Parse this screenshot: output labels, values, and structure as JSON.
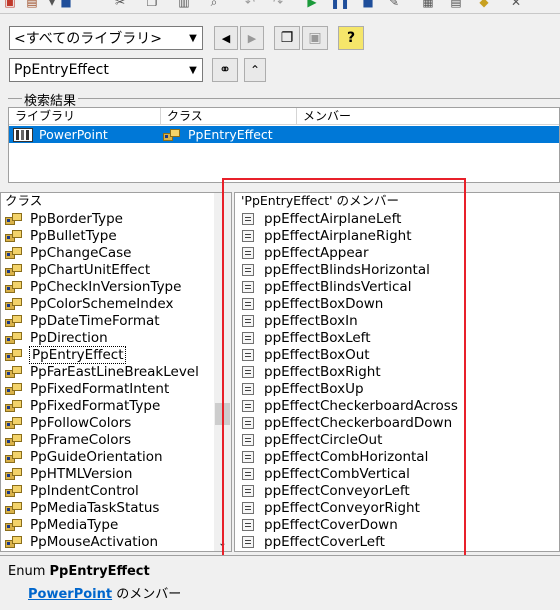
{
  "toolbar": {
    "icons": [
      "view-icon",
      "insert-icon",
      "save-icon",
      "cut-icon",
      "copy-icon",
      "paste-icon",
      "find-icon",
      "undo-icon",
      "redo-icon",
      "run-icon",
      "break-icon",
      "reset-icon",
      "design-icon",
      "project-icon",
      "properties-icon",
      "object-browser-icon",
      "toolbox-icon"
    ]
  },
  "library_combo": {
    "value": "<すべてのライブラリ>"
  },
  "search_combo": {
    "value": "PpEntryEffect"
  },
  "nav_buttons": {
    "back": "◀",
    "forward": "▶",
    "copy": "",
    "view_def": "",
    "help": "?"
  },
  "search_results": {
    "label": "検索結果",
    "columns": [
      "ライブラリ",
      "クラス",
      "メンバー"
    ],
    "row": {
      "library": "PowerPoint",
      "class": "PpEntryEffect",
      "member": ""
    }
  },
  "classes_pane": {
    "title": "クラス",
    "items": [
      "PpBorderType",
      "PpBulletType",
      "PpChangeCase",
      "PpChartUnitEffect",
      "PpCheckInVersionType",
      "PpColorSchemeIndex",
      "PpDateTimeFormat",
      "PpDirection",
      "PpEntryEffect",
      "PpFarEastLineBreakLevel",
      "PpFixedFormatIntent",
      "PpFixedFormatType",
      "PpFollowColors",
      "PpFrameColors",
      "PpGuideOrientation",
      "PpHTMLVersion",
      "PpIndentControl",
      "PpMediaTaskStatus",
      "PpMediaType",
      "PpMouseActivation"
    ],
    "selected_index": 8
  },
  "members_pane": {
    "title": "'PpEntryEffect' のメンバー",
    "items": [
      "ppEffectAirplaneLeft",
      "ppEffectAirplaneRight",
      "ppEffectAppear",
      "ppEffectBlindsHorizontal",
      "ppEffectBlindsVertical",
      "ppEffectBoxDown",
      "ppEffectBoxIn",
      "ppEffectBoxLeft",
      "ppEffectBoxOut",
      "ppEffectBoxRight",
      "ppEffectBoxUp",
      "ppEffectCheckerboardAcross",
      "ppEffectCheckerboardDown",
      "ppEffectCircleOut",
      "ppEffectCombHorizontal",
      "ppEffectCombVertical",
      "ppEffectConveyorLeft",
      "ppEffectConveyorRight",
      "ppEffectCoverDown",
      "ppEffectCoverLeft"
    ]
  },
  "details": {
    "prefix": "Enum ",
    "name": "PpEntryEffect",
    "parent_link": "PowerPoint",
    "parent_suffix": " のメンバー"
  },
  "colors": {
    "selection": "#0078d7",
    "highlight_box": "#e8202a",
    "link": "#0066cc"
  }
}
